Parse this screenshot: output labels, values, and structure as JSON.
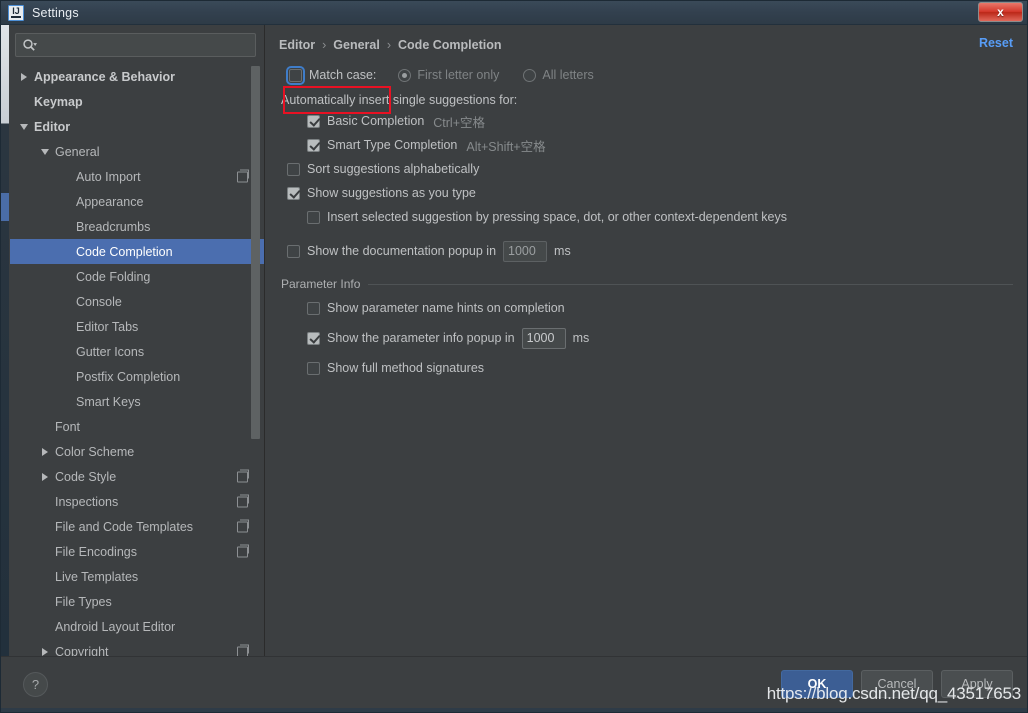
{
  "window": {
    "title": "Settings",
    "app_icon": "intellij-idea-icon",
    "close_label": "x"
  },
  "sidebar": {
    "search": {
      "placeholder": "",
      "value": "",
      "icon": "search-icon"
    },
    "items": [
      {
        "label": "Appearance & Behavior",
        "indent": 0,
        "arrow": "collapsed",
        "bold": true,
        "selected": false,
        "copy_icon": false
      },
      {
        "label": "Keymap",
        "indent": 0,
        "arrow": "none",
        "bold": true,
        "selected": false,
        "copy_icon": false
      },
      {
        "label": "Editor",
        "indent": 0,
        "arrow": "expanded",
        "bold": true,
        "selected": false,
        "copy_icon": false
      },
      {
        "label": "General",
        "indent": 1,
        "arrow": "expanded",
        "bold": false,
        "selected": false,
        "copy_icon": false
      },
      {
        "label": "Auto Import",
        "indent": 2,
        "arrow": "none",
        "bold": false,
        "selected": false,
        "copy_icon": true
      },
      {
        "label": "Appearance",
        "indent": 2,
        "arrow": "none",
        "bold": false,
        "selected": false,
        "copy_icon": false
      },
      {
        "label": "Breadcrumbs",
        "indent": 2,
        "arrow": "none",
        "bold": false,
        "selected": false,
        "copy_icon": false
      },
      {
        "label": "Code Completion",
        "indent": 2,
        "arrow": "none",
        "bold": false,
        "selected": true,
        "copy_icon": false
      },
      {
        "label": "Code Folding",
        "indent": 2,
        "arrow": "none",
        "bold": false,
        "selected": false,
        "copy_icon": false
      },
      {
        "label": "Console",
        "indent": 2,
        "arrow": "none",
        "bold": false,
        "selected": false,
        "copy_icon": false
      },
      {
        "label": "Editor Tabs",
        "indent": 2,
        "arrow": "none",
        "bold": false,
        "selected": false,
        "copy_icon": false
      },
      {
        "label": "Gutter Icons",
        "indent": 2,
        "arrow": "none",
        "bold": false,
        "selected": false,
        "copy_icon": false
      },
      {
        "label": "Postfix Completion",
        "indent": 2,
        "arrow": "none",
        "bold": false,
        "selected": false,
        "copy_icon": false
      },
      {
        "label": "Smart Keys",
        "indent": 2,
        "arrow": "none",
        "bold": false,
        "selected": false,
        "copy_icon": false
      },
      {
        "label": "Font",
        "indent": 1,
        "arrow": "none",
        "bold": false,
        "selected": false,
        "copy_icon": false
      },
      {
        "label": "Color Scheme",
        "indent": 1,
        "arrow": "collapsed",
        "bold": false,
        "selected": false,
        "copy_icon": false
      },
      {
        "label": "Code Style",
        "indent": 1,
        "arrow": "collapsed",
        "bold": false,
        "selected": false,
        "copy_icon": true
      },
      {
        "label": "Inspections",
        "indent": 1,
        "arrow": "none",
        "bold": false,
        "selected": false,
        "copy_icon": true
      },
      {
        "label": "File and Code Templates",
        "indent": 1,
        "arrow": "none",
        "bold": false,
        "selected": false,
        "copy_icon": true
      },
      {
        "label": "File Encodings",
        "indent": 1,
        "arrow": "none",
        "bold": false,
        "selected": false,
        "copy_icon": true
      },
      {
        "label": "Live Templates",
        "indent": 1,
        "arrow": "none",
        "bold": false,
        "selected": false,
        "copy_icon": false
      },
      {
        "label": "File Types",
        "indent": 1,
        "arrow": "none",
        "bold": false,
        "selected": false,
        "copy_icon": false
      },
      {
        "label": "Android Layout Editor",
        "indent": 1,
        "arrow": "none",
        "bold": false,
        "selected": false,
        "copy_icon": false
      },
      {
        "label": "Copyright",
        "indent": 1,
        "arrow": "collapsed",
        "bold": false,
        "selected": false,
        "copy_icon": true
      }
    ]
  },
  "main": {
    "breadcrumb": {
      "items": [
        "Editor",
        "General",
        "Code Completion"
      ],
      "separator": "›"
    },
    "reset_label": "Reset",
    "match_case": {
      "label": "Match case:",
      "checked": false,
      "highlighted": true,
      "options": [
        {
          "label": "First letter only",
          "selected": true,
          "enabled": false
        },
        {
          "label": "All letters",
          "selected": false,
          "enabled": false
        }
      ]
    },
    "auto_insert_label": "Automatically insert single suggestions for:",
    "auto_insert_items": [
      {
        "label": "Basic Completion",
        "shortcut": "Ctrl+空格",
        "checked": true
      },
      {
        "label": "Smart Type Completion",
        "shortcut": "Alt+Shift+空格",
        "checked": true
      }
    ],
    "options": [
      {
        "label": "Sort suggestions alphabetically",
        "checked": false,
        "indent": 0
      },
      {
        "label": "Show suggestions as you type",
        "checked": true,
        "indent": 0
      },
      {
        "label": "Insert selected suggestion by pressing space, dot, or other context-dependent keys",
        "checked": false,
        "indent": 1
      }
    ],
    "doc_popup": {
      "label": "Show the documentation popup in",
      "checked": false,
      "value": "1000",
      "unit": "ms",
      "enabled": false
    },
    "parameter_info": {
      "group_title": "Parameter Info",
      "items": [
        {
          "label": "Show parameter name hints on completion",
          "checked": false,
          "type": "checkbox"
        },
        {
          "label": "Show the parameter info popup in",
          "checked": true,
          "type": "spinner",
          "value": "1000",
          "unit": "ms",
          "enabled": true
        },
        {
          "label": "Show full method signatures",
          "checked": false,
          "type": "checkbox"
        }
      ]
    }
  },
  "footer": {
    "help_label": "?",
    "buttons": [
      {
        "label": "OK",
        "style": "primary"
      },
      {
        "label": "Cancel",
        "style": "secondary"
      },
      {
        "label": "Apply",
        "style": "secondary"
      }
    ]
  },
  "watermark": "https://blog.csdn.net/qq_43517653",
  "colors": {
    "background": "#3c3f41",
    "titlebar": "#33414f",
    "selection": "#4b6eaf",
    "link": "#589df6",
    "highlight_border": "#e81123",
    "close_button": "#d4382b"
  }
}
